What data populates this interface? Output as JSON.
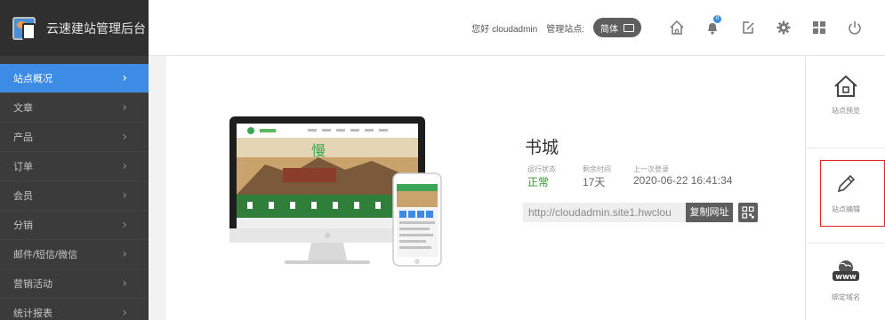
{
  "brand": {
    "title": "云速建站管理后台",
    "icon": "site-logo-icon"
  },
  "sidebar": {
    "items": [
      {
        "label": "站点概况",
        "active": true
      },
      {
        "label": "文章"
      },
      {
        "label": "产品"
      },
      {
        "label": "订单"
      },
      {
        "label": "会员"
      },
      {
        "label": "分销"
      },
      {
        "label": "邮件/短信/微信"
      },
      {
        "label": "营销活动"
      },
      {
        "label": "统计报表"
      }
    ]
  },
  "topbar": {
    "greeting": "您好 cloudadmin",
    "site_label": "管理站点:",
    "lang": "简体",
    "icons": [
      "home-icon",
      "notification-icon",
      "edit-icon",
      "settings-icon",
      "apps-icon",
      "power-icon"
    ],
    "notification_count": "0"
  },
  "site": {
    "title": "书城",
    "status_label": "运行状态",
    "status_value": "正常",
    "remaining_label": "剩余时间",
    "remaining_value": "17天",
    "last_login_label": "上一次登录",
    "last_login_value": "2020-06-22 16:41:34",
    "url": "http://cloudadmin.site1.hwclou",
    "copy_label": "复制网址"
  },
  "right_panel": {
    "items": [
      {
        "label": "站点预览",
        "icon": "home-icon"
      },
      {
        "label": "站点编辑",
        "icon": "pencil-icon"
      },
      {
        "label": "绑定域名",
        "icon": "www-icon"
      }
    ]
  },
  "colors": {
    "accent": "#3c8be4",
    "ok": "#2e9a2e",
    "highlight": "#e02424"
  }
}
